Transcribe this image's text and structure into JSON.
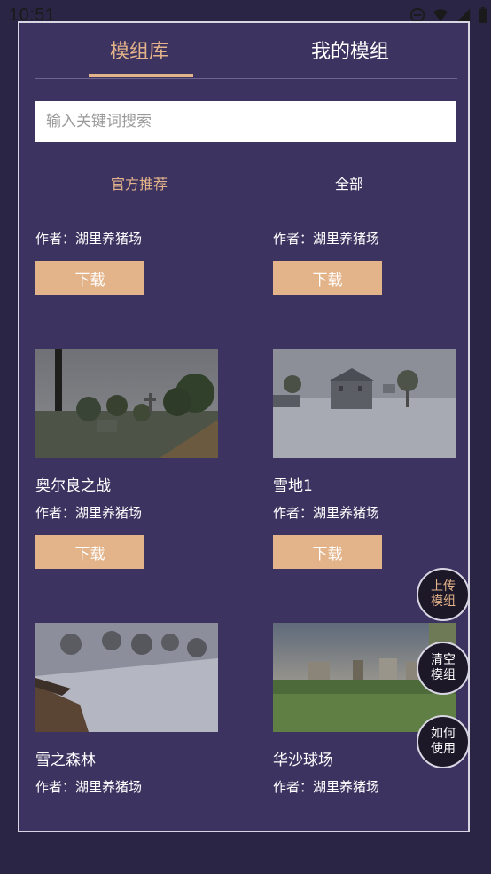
{
  "status_bar": {
    "time": "10:51"
  },
  "tabs": [
    {
      "label": "模组库",
      "active": true
    },
    {
      "label": "我的模组",
      "active": false
    }
  ],
  "search": {
    "placeholder": "输入关键词搜索",
    "value": ""
  },
  "filters": [
    {
      "label": "官方推荐",
      "active": true
    },
    {
      "label": "全部",
      "active": false
    }
  ],
  "mods": [
    {
      "title": "",
      "author": "作者：湖里养猪场",
      "download_label": "下载"
    },
    {
      "title": "",
      "author": "作者：湖里养猪场",
      "download_label": "下载"
    },
    {
      "title": "奥尔良之战",
      "author": "作者：湖里养猪场",
      "download_label": "下载"
    },
    {
      "title": "雪地1",
      "author": "作者：湖里养猪场",
      "download_label": "下载"
    },
    {
      "title": "雪之森林",
      "author": "作者：湖里养猪场"
    },
    {
      "title": "华沙球场",
      "author": "作者：湖里养猪场"
    }
  ],
  "fabs": {
    "upload": {
      "line1": "上传",
      "line2": "模组"
    },
    "clear": {
      "line1": "清空",
      "line2": "模组"
    },
    "howto": {
      "line1": "如何",
      "line2": "使用"
    }
  },
  "colors": {
    "background": "#3d3360",
    "accent": "#e3b389",
    "fab_bg": "#1c1828"
  }
}
